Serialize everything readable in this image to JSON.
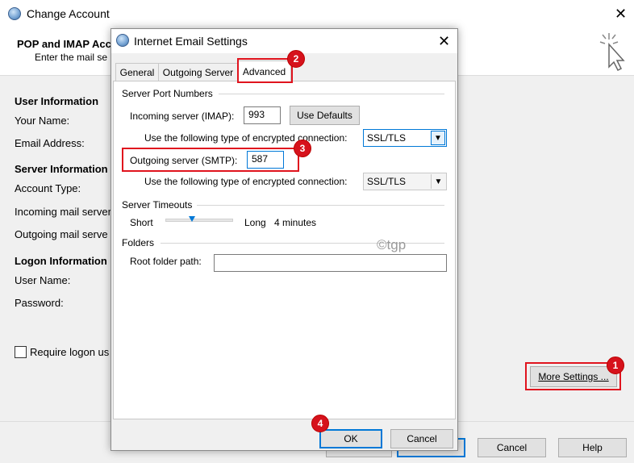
{
  "back_window": {
    "title": "Change Account",
    "header_title": "POP and IMAP Acc",
    "header_subtitle": "Enter the mail se",
    "sections": {
      "user_info": "User Information",
      "server_info": "Server Information",
      "logon_info": "Logon Information"
    },
    "labels": {
      "your_name": "Your Name:",
      "email": "Email Address:",
      "account_type": "Account Type:",
      "incoming": "Incoming mail server",
      "outgoing": "Outgoing mail serve",
      "user_name": "User Name:",
      "password": "Password:"
    },
    "require_logon": "Require logon us",
    "more_settings": "More Settings ...",
    "cancel": "Cancel",
    "help": "Help"
  },
  "dialog": {
    "title": "Internet Email Settings",
    "tabs": [
      "General",
      "Outgoing Server",
      "Advanced"
    ],
    "server_port_numbers": "Server Port Numbers",
    "incoming_label": "Incoming server (IMAP):",
    "incoming_value": "993",
    "use_defaults": "Use Defaults",
    "encrypt_label": "Use the following type of encrypted connection:",
    "incoming_encryption": "SSL/TLS",
    "outgoing_label": "Outgoing server (SMTP):",
    "outgoing_value": "587",
    "outgoing_encryption": "SSL/TLS",
    "server_timeouts": "Server Timeouts",
    "short": "Short",
    "long": "Long",
    "timeout_value": "4 minutes",
    "folders": "Folders",
    "root_folder_label": "Root folder path:",
    "root_folder_value": "",
    "ok": "OK",
    "cancel": "Cancel"
  },
  "watermark": "©tgp",
  "badges": [
    "1",
    "2",
    "3",
    "4"
  ],
  "colors": {
    "annotation_red": "#e0141e",
    "focus_blue": "#0078d7"
  }
}
